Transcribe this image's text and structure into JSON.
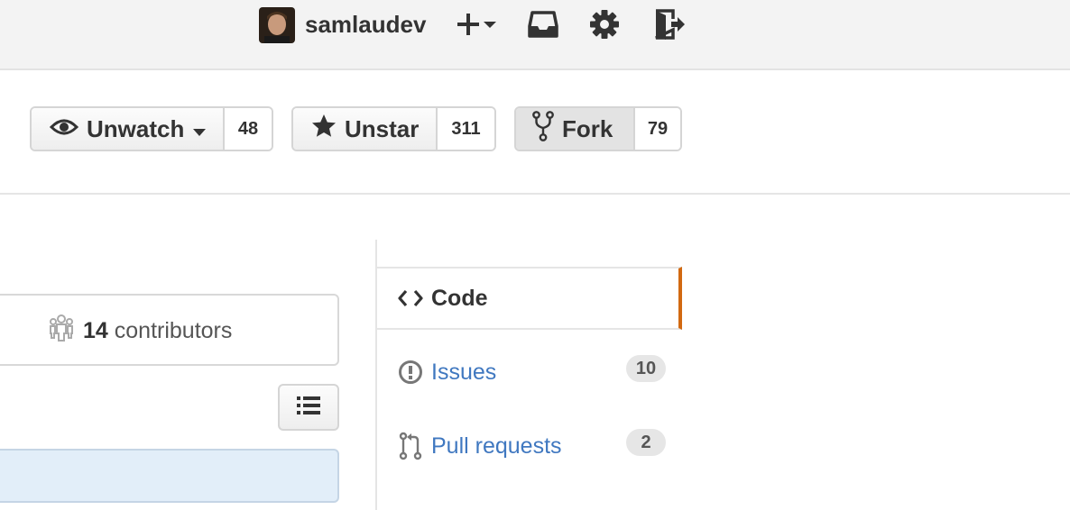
{
  "header": {
    "username": "samlaudev",
    "icons": [
      "plus-icon",
      "caret-down-icon",
      "inbox-icon",
      "gear-icon",
      "sign-out-icon"
    ]
  },
  "repo_actions": {
    "watch": {
      "label": "Unwatch",
      "count": "48",
      "icon": "eye-icon"
    },
    "star": {
      "label": "Unstar",
      "count": "311",
      "icon": "star-icon"
    },
    "fork": {
      "label": "Fork",
      "count": "79",
      "icon": "fork-icon"
    }
  },
  "contributors": {
    "count": "14",
    "label": "contributors"
  },
  "repo_nav": {
    "items": [
      {
        "label": "Code",
        "icon": "code-icon",
        "selected": true
      },
      {
        "label": "Issues",
        "icon": "issue-opened-icon",
        "count": "10"
      },
      {
        "label": "Pull requests",
        "icon": "git-pull-request-icon",
        "count": "2"
      }
    ]
  },
  "colors": {
    "link": "#4078c0",
    "selected_accent": "#d26911",
    "header_bg": "#f3f3f3"
  }
}
